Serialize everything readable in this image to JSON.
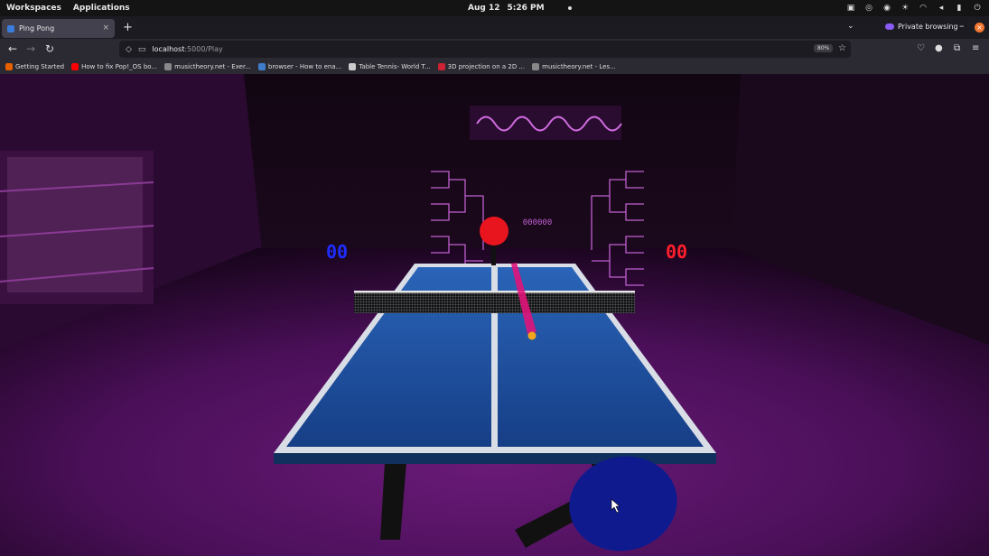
{
  "system_bar": {
    "workspaces": "Workspaces",
    "applications": "Applications",
    "date": "Aug 12",
    "time": "5:26 PM"
  },
  "browser": {
    "tab_title": "Ping Pong",
    "tab_close": "×",
    "new_tab": "+",
    "private_label": "Private browsing",
    "url_host": "localhost",
    "url_path": ":5000/Play",
    "zoom_level": "80%"
  },
  "bookmarks": [
    {
      "label": "Getting Started",
      "color": "#e66000"
    },
    {
      "label": "How to fix Pop!_OS bo...",
      "color": "#ff0000"
    },
    {
      "label": "musictheory.net - Exer...",
      "color": "#888888"
    },
    {
      "label": "browser - How to ena...",
      "color": "#3d7dca"
    },
    {
      "label": "Table Tennis- World T...",
      "color": "#cccccc"
    },
    {
      "label": "3D projection on a 2D ...",
      "color": "#cc2233"
    },
    {
      "label": "musictheory.net - Les...",
      "color": "#888888"
    }
  ],
  "game": {
    "score_left": "00",
    "score_right": "00",
    "score_left_color": "#1e2cff",
    "score_right_color": "#ff1e2c",
    "bracket_center": "000000",
    "table_color": "#1c4f9e",
    "player_paddle_color": "#0f1a8f",
    "opponent_paddle_color": "#e8141e",
    "ball_color": "#f2a61c"
  }
}
